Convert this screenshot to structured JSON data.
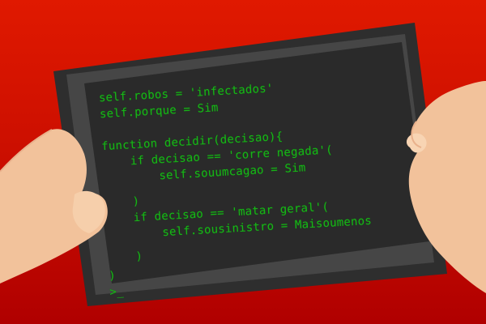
{
  "colors": {
    "background": "#d81300",
    "tablet_frame": "#2f2f2f",
    "tablet_bezel": "#474747",
    "screen": "#2b2b2b",
    "code_text": "#18b418",
    "skin": "#f1c19a"
  },
  "code": {
    "lines": [
      "self.robos = 'infectados'",
      "self.porque = Sim",
      "",
      "function decidir(decisao){",
      "    if decisao == 'corre negada'(",
      "        self.souumcagao = Sim",
      "",
      "    )",
      "    if decisao == 'matar geral'(",
      "        self.sousinistro = Maisoumenos",
      "",
      "    )",
      "",
      ")",
      ">_"
    ]
  },
  "icons": {
    "left_hand": "hand-icon",
    "right_hand": "hand-icon"
  }
}
